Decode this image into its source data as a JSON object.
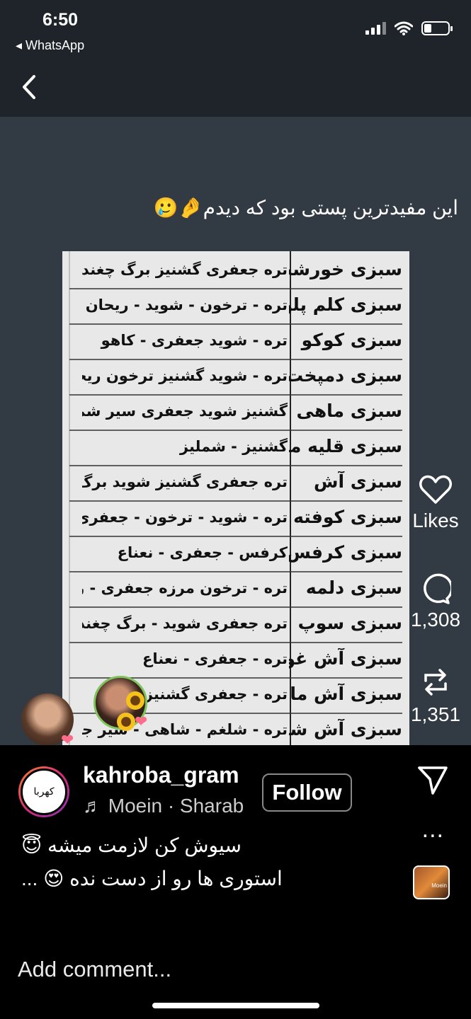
{
  "status_bar": {
    "time": "6:50",
    "back_app": "◂ WhatsApp",
    "signal_icon": "cellular-signal-icon",
    "wifi_icon": "wifi-icon",
    "battery_level": 0.3
  },
  "nav": {
    "back_icon": "chevron-left-icon"
  },
  "story": {
    "caption": "این مفیدترین پستی بود که دیدم🤌🥲",
    "list": [
      {
        "name": "سبزی خورشت",
        "items": "تره جعفری گشنیز برگ چغندر شملیز"
      },
      {
        "name": "سبزی کلم پلو",
        "items": "تره - ترخون - شوید - ریحان"
      },
      {
        "name": "سبزی کوکو",
        "items": "تره - شوید جعفری - کاهو"
      },
      {
        "name": "سبزی دمپخت",
        "items": "تره - شوید گشنیز ترخون ریحان"
      },
      {
        "name": "سبزی ماهی پلو",
        "items": "گشنیز شوید جعفری سیر شملیز"
      },
      {
        "name": "سبزی قلیه ماهی",
        "items": "گشنیز - شملیز"
      },
      {
        "name": "سبزی آش",
        "items": "تره جعفری گشنیز شوید برگ چغندر"
      },
      {
        "name": "سبزی کوفته",
        "items": "تره - شوید - ترخون - جعفری"
      },
      {
        "name": "سبزی کرفس",
        "items": "کرفس - جعفری - نعناع"
      },
      {
        "name": "سبزی دلمه",
        "items": "تره - ترخون مرزه جعفری - ریحان"
      },
      {
        "name": "سبزی سوپ",
        "items": "تره جعفری شوید - برگ چغندر"
      },
      {
        "name": "سبزی آش غوره",
        "items": "تره - جعفری - نعناع"
      },
      {
        "name": "سبزی آش ماست",
        "items": "تره - جعفری گشنیز شوید"
      },
      {
        "name": "سبزی آش شلغم",
        "items": "تره - شلغم - شاهی - سیر جعفری"
      }
    ],
    "actions": {
      "like_icon": "heart-icon",
      "like_label": "Likes",
      "comment_icon": "comment-icon",
      "comment_count": "1,308",
      "repost_icon": "repost-icon",
      "repost_count": "1,351"
    }
  },
  "post": {
    "username": "kahroba_gram",
    "avatar_text": "کهربا",
    "music": "♬ Moein · Sharab",
    "follow_label": "Follow",
    "share_icon": "send-icon",
    "more_label": "...",
    "caption_line1": "سیوش کن لازمت میشه 😇",
    "caption_line2": "استوری ها رو از دست نده 😍 ...",
    "music_thumb_label": "Moein",
    "comment_placeholder": "Add comment..."
  }
}
